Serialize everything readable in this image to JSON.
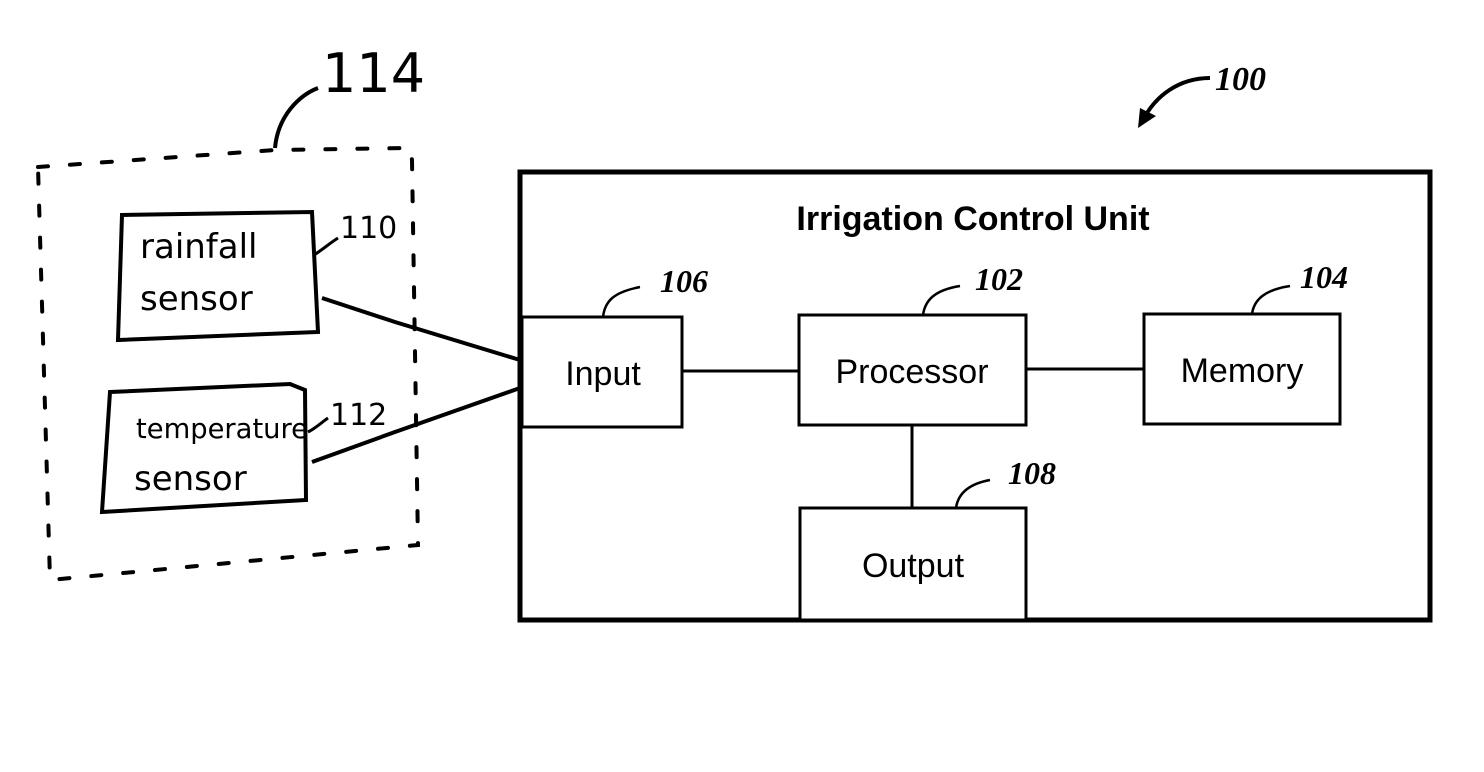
{
  "figure": {
    "ref_system": "100",
    "sensor_group": {
      "ref": "114",
      "sensors": [
        {
          "ref": "110",
          "line1": "rainfall",
          "line2": "sensor"
        },
        {
          "ref": "112",
          "line1": "temperature",
          "line2": "sensor"
        }
      ]
    },
    "control_unit": {
      "title": "Irrigation Control Unit",
      "blocks": {
        "input": {
          "label": "Input",
          "ref": "106"
        },
        "processor": {
          "label": "Processor",
          "ref": "102"
        },
        "memory": {
          "label": "Memory",
          "ref": "104"
        },
        "output": {
          "label": "Output",
          "ref": "108"
        }
      }
    },
    "connections": [
      {
        "from": "rainfall sensor",
        "to": "Input"
      },
      {
        "from": "temperature sensor",
        "to": "Input"
      },
      {
        "from": "Input",
        "to": "Processor"
      },
      {
        "from": "Processor",
        "to": "Memory"
      },
      {
        "from": "Processor",
        "to": "Output"
      }
    ]
  }
}
